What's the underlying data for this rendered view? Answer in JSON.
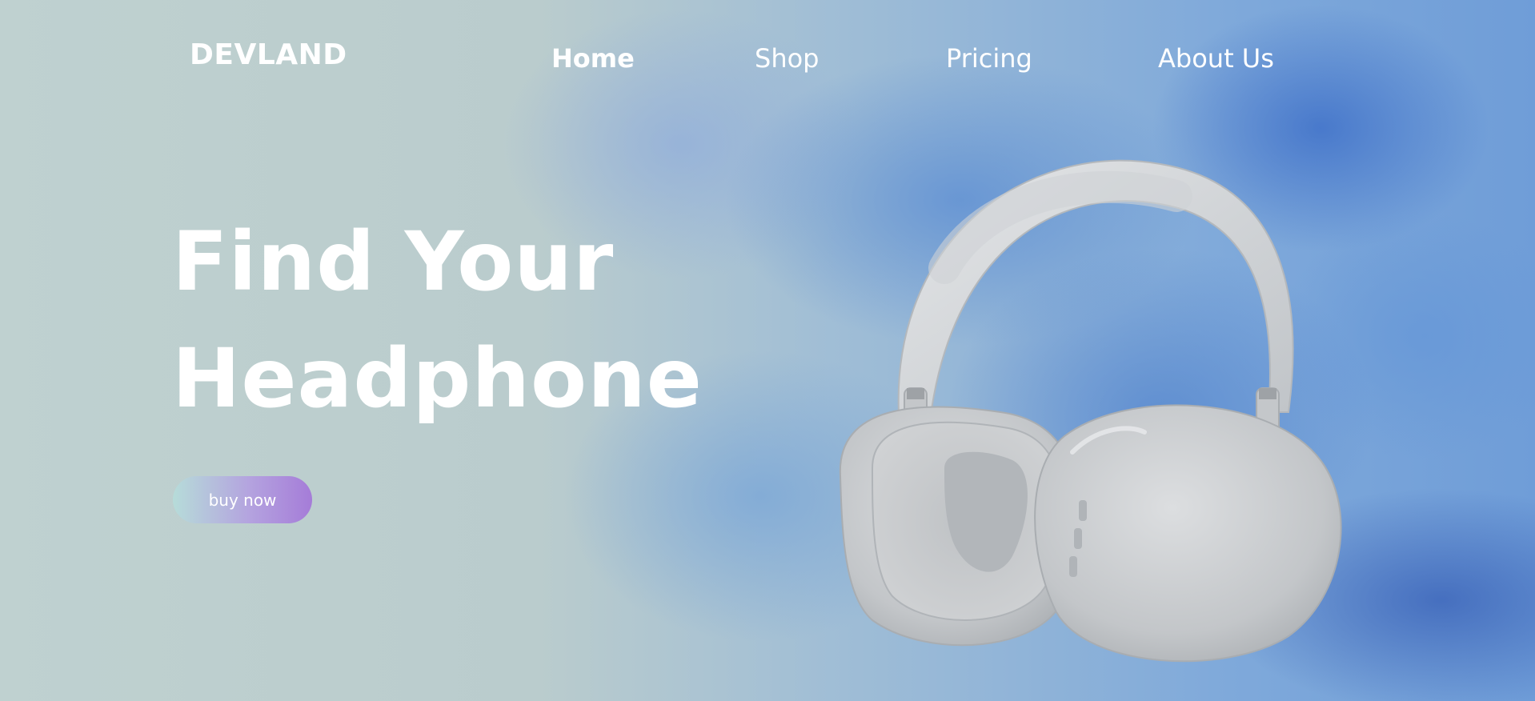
{
  "nav": {
    "brand": "DEVLAND",
    "links": [
      {
        "label": "Home",
        "active": true
      },
      {
        "label": "Shop",
        "active": false
      },
      {
        "label": "Pricing",
        "active": false
      },
      {
        "label": "About Us",
        "active": false
      }
    ]
  },
  "hero": {
    "headline_line1": "Find Your",
    "headline_line2": "Headphone",
    "cta_label": "buy now"
  },
  "images": {
    "product": "headphones-image",
    "background": "blue-smoke-background"
  },
  "colors": {
    "text": "#ffffff",
    "cta_gradient_start": "#b6dcd9",
    "cta_gradient_end": "#a57cd8",
    "background_left": "#bfd1d0",
    "background_right": "#6f9dd8"
  }
}
